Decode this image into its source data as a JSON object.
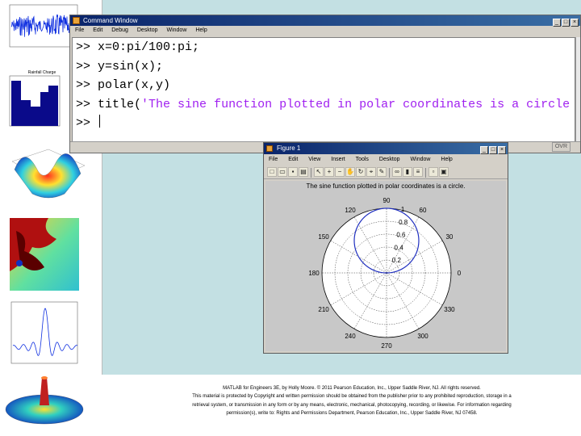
{
  "command_window": {
    "title": "Command Window",
    "menu": [
      "File",
      "Edit",
      "Debug",
      "Desktop",
      "Window",
      "Help"
    ],
    "window_buttons": [
      "_",
      "□",
      "×"
    ],
    "prompt": ">>",
    "lines": [
      {
        "code": "x=0:pi/100:pi;"
      },
      {
        "code": "y=sin(x);"
      },
      {
        "code": "polar(x,y)"
      },
      {
        "code_before": "title(",
        "string": "'The sine function plotted in polar coordinates is a circle"
      }
    ],
    "status": "OVR"
  },
  "figure_window": {
    "title": "Figure 1",
    "menu": [
      "File",
      "Edit",
      "View",
      "Insert",
      "Tools",
      "Desktop",
      "Window",
      "Help"
    ],
    "window_buttons": [
      "_",
      "□",
      "×"
    ],
    "toolbar_icons": [
      "new-figure-icon",
      "open-file-icon",
      "save-icon",
      "print-icon",
      "pointer-icon",
      "zoom-in-icon",
      "zoom-out-icon",
      "pan-icon",
      "rotate-icon",
      "data-cursor-icon",
      "brush-icon",
      "link-icon",
      "colorbar-icon",
      "legend-icon",
      "hide-plot-tools-icon",
      "show-plot-tools-icon"
    ]
  },
  "chart_data": {
    "type": "polar",
    "title": "The sine function plotted in polar coordinates is a circle.",
    "theta_ticks": [
      "0",
      "30",
      "60",
      "90",
      "120",
      "150",
      "180",
      "210",
      "240",
      "270",
      "300",
      "330"
    ],
    "r_ticks": [
      "0.2",
      "0.4",
      "0.6",
      "0.8",
      "1"
    ],
    "rlim": [
      0,
      1
    ],
    "series": [
      {
        "theta_range": [
          0,
          3.1416
        ],
        "r": "sin(theta)",
        "color": "#2030c0"
      }
    ]
  },
  "thumbnails": {
    "bar_chart_title": "Rainfall Charge"
  },
  "caption": {
    "line1": "MATLAB for Engineers 3E, by Holly Moore. © 2011 Pearson Education, Inc., Upper Saddle River, NJ. All rights reserved.",
    "line2": "This material is protected by Copyright and written permission should be obtained from the publisher prior to any prohibited reproduction, storage in a",
    "line3": "retrieval system, or transmission in any form or by any means, electronic, mechanical, photocopying, recording, or likewise. For information regarding",
    "line4": "permission(s), write to: Rights and Permissions Department, Pearson Education, Inc., Upper Saddle River, NJ 07458."
  },
  "colors": {
    "slide_bg": "#c3e0e3",
    "title_bar": "#0a246a",
    "string": "#a020f0",
    "plot_line": "#2030c0"
  }
}
